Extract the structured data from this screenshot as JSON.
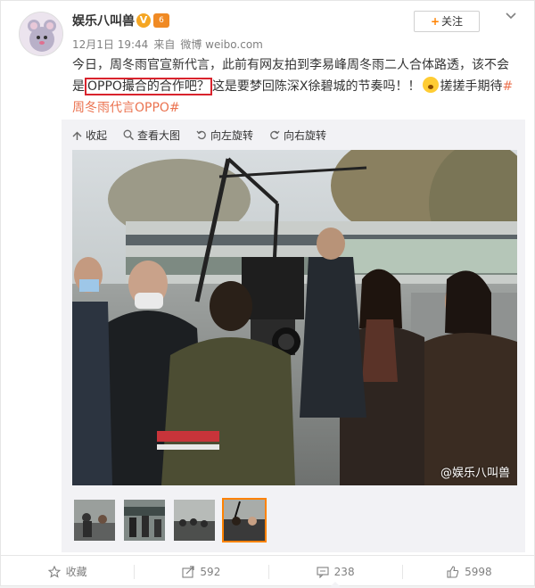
{
  "user": {
    "name": "娱乐八叫兽",
    "verified_badge": "V",
    "level_badge": "6"
  },
  "meta": {
    "time": "12月1日 19:44",
    "from": "来自",
    "source": "微博 weibo.com"
  },
  "follow": {
    "plus": "+",
    "label": "关注"
  },
  "post": {
    "text_before": "今日，周冬雨官宣新代言，此前有网友拍到李易峰周冬雨二人合体路透，该不会是",
    "highlight": "OPPO撮合的合作吧？",
    "text_after": "这是要梦回陈深X徐碧城的节奏吗！！",
    "text_after_emoji": "搓搓手期待",
    "topic": "#周冬雨代言OPPO#"
  },
  "toolbar": {
    "collapse": "收起",
    "view_large": "查看大图",
    "rotate_left": "向左旋转",
    "rotate_right": "向右旋转"
  },
  "photo": {
    "watermark": "@娱乐八叫兽"
  },
  "thumbnails": {
    "count": 4,
    "active_index": 3
  },
  "footer": {
    "favorite": "收藏",
    "repost_count": "592",
    "comment_count": "238",
    "like_count": "5998"
  },
  "colors": {
    "accent": "#ff8200",
    "topic": "#eb7350",
    "highlight_border": "#d9232d"
  },
  "icons": {
    "more": "chevron-down-icon",
    "collapse": "collapse-icon",
    "view": "magnifier-icon",
    "rotate_left": "rotate-left-icon",
    "rotate_right": "rotate-right-icon",
    "favorite": "star-icon",
    "repost": "repost-icon",
    "comment": "comment-icon",
    "like": "thumbs-up-icon"
  }
}
